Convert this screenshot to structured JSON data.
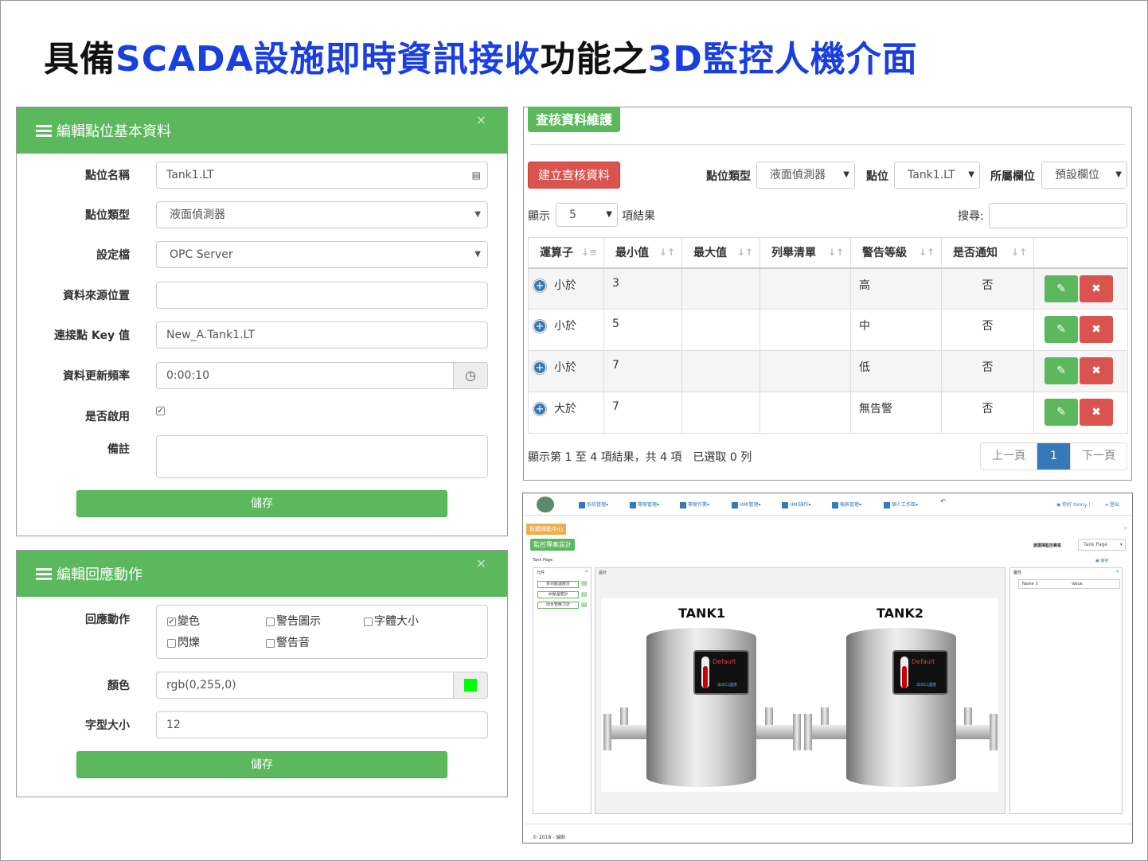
{
  "slide": {
    "title_black_1": "具備",
    "title_blue_1": "SCADA設施即時資訊接收",
    "title_black_2": "功能之",
    "title_blue_2": "3D監控人機介面"
  },
  "point_form": {
    "title": "編輯點位基本資料",
    "close": "×",
    "fields": [
      {
        "label": "點位名稱",
        "value": "Tank1.LT"
      },
      {
        "label": "點位類型",
        "value": "液面偵測器"
      },
      {
        "label": "設定檔",
        "value": "OPC Server"
      },
      {
        "label": "資料來源位置",
        "value": ""
      },
      {
        "label": "連接點 Key 值",
        "value": "New_A.Tank1.LT"
      },
      {
        "label": "資料更新頻率",
        "value": "0:00:10"
      }
    ],
    "enabled_label": "是否啟用",
    "note_label": "備註",
    "save": "儲存"
  },
  "response_form": {
    "title": "編輯回應動作",
    "close": "×",
    "action_label": "回應動作",
    "options": [
      "變色",
      "警告圖示",
      "字體大小",
      "閃爍",
      "警告音"
    ],
    "color_label": "顏色",
    "color_value": "rgb(0,255,0)",
    "swatch_color": "#00ff00",
    "font_label": "字型大小",
    "font_value": "12",
    "save": "儲存"
  },
  "maintenance": {
    "title": "查核資料維護",
    "create": "建立查核資料",
    "type_label": "點位類型",
    "type_value": "液面偵測器",
    "point_label": "點位",
    "point_value": "Tank1.LT",
    "field_label": "所屬欄位",
    "field_value": "預設欄位",
    "show": "顯示",
    "page_size": "5",
    "results": "項結果",
    "search": "搜尋:",
    "columns": [
      "運算子",
      "最小值",
      "最大值",
      "列舉清單",
      "警告等級",
      "是否通知"
    ],
    "rows": [
      {
        "op": "小於",
        "min": "3",
        "level": "高",
        "notify": "否"
      },
      {
        "op": "小於",
        "min": "5",
        "level": "中",
        "notify": "否"
      },
      {
        "op": "小於",
        "min": "7",
        "level": "低",
        "notify": "否"
      },
      {
        "op": "大於",
        "min": "7",
        "level": "無告警",
        "notify": "否"
      }
    ],
    "info": "顯示第 1 至 4 項結果，共 4 項　已選取 0 列",
    "prev": "上一頁",
    "page": "1",
    "next": "下一頁"
  },
  "hmi": {
    "nav": [
      "系統管理▾",
      "專案管理▾",
      "專案作業▾",
      "HMI管理▾",
      "HMI操作▾",
      "報表管理▾",
      "個人工作區▾"
    ],
    "user": "你好 tonny !",
    "logout": "登出",
    "center": "板橋揮動中心",
    "project": "監控專案設計",
    "choose": "請選擇監控專案",
    "choose_value": "Tank Page",
    "page_name": "Tank Page",
    "save": "儲存",
    "panel_left": "元件",
    "panel_mid": "設計",
    "panel_right": "屬性",
    "widgets": [
      "多功能溫度計",
      "水壓溫度計",
      "出水管壓力計"
    ],
    "col_name": "Name ⇕",
    "col_value": "Value",
    "tank1": "TANK1",
    "tank2": "TANK2",
    "thermo_default": "Default",
    "thermo_sub": "出水口溫度",
    "footer": "© 2018 - 瑞助"
  }
}
